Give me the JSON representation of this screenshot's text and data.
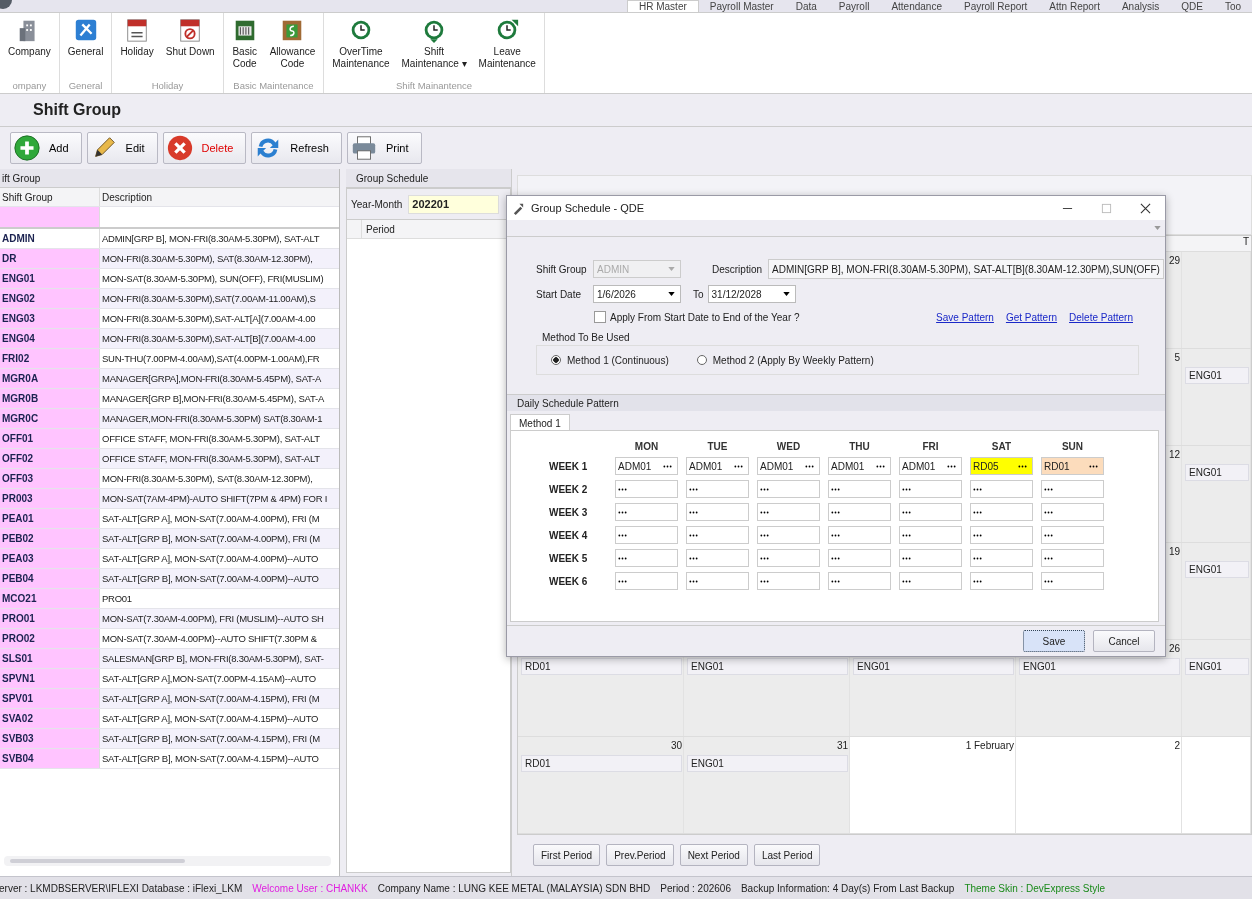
{
  "top_tabs": [
    {
      "label": "HR Master",
      "selected": true
    },
    {
      "label": "Payroll Master",
      "selected": false
    },
    {
      "label": "Data",
      "selected": false
    },
    {
      "label": "Payroll",
      "selected": false
    },
    {
      "label": "Attendance",
      "selected": false
    },
    {
      "label": "Payroll Report",
      "selected": false
    },
    {
      "label": "Attn Report",
      "selected": false
    },
    {
      "label": "Analysis",
      "selected": false
    },
    {
      "label": "QDE",
      "selected": false
    },
    {
      "label": "Too",
      "selected": false
    }
  ],
  "ribbon": [
    {
      "label": "ompany",
      "items": [
        {
          "label": "Company"
        }
      ]
    },
    {
      "label": "General",
      "items": [
        {
          "label": "General"
        }
      ]
    },
    {
      "label": "Holiday",
      "items": [
        {
          "label": "Holiday"
        },
        {
          "label": "Shut Down"
        }
      ]
    },
    {
      "label": "Basic Maintenance",
      "items": [
        {
          "label": "Basic\nCode"
        },
        {
          "label": "Allowance\nCode"
        }
      ]
    },
    {
      "label": "Shift Mainantence",
      "items": [
        {
          "label": "OverTime\nMaintenance"
        },
        {
          "label": "Shift\nMaintenance ▾"
        },
        {
          "label": "Leave\nMaintenance"
        }
      ]
    }
  ],
  "page_title": "Shift Group",
  "toolbar": [
    {
      "label": "Add"
    },
    {
      "label": "Edit"
    },
    {
      "label": "Delete",
      "color": "#e00000"
    },
    {
      "label": "Refresh"
    },
    {
      "label": "Print"
    }
  ],
  "shift_panel": {
    "title": "ift Group",
    "columns": [
      "Shift Group",
      "Description"
    ],
    "rows": [
      {
        "code": "ADMIN",
        "description": "ADMIN[GRP B], MON-FRI(8.30AM-5.30PM), SAT-ALT",
        "selected": true
      },
      {
        "code": "DR",
        "description": "MON-FRI(8.30AM-5.30PM), SAT(8.30AM-12.30PM),",
        "selected": false
      },
      {
        "code": "ENG01",
        "description": "MON-SAT(8.30AM-5.30PM), SUN(OFF), FRI(MUSLIM)",
        "selected": false
      },
      {
        "code": "ENG02",
        "description": "MON-FRI(8.30AM-5.30PM),SAT(7.00AM-11.00AM),S",
        "selected": false
      },
      {
        "code": "ENG03",
        "description": "MON-FRI(8.30AM-5.30PM),SAT-ALT[A](7.00AM-4.00",
        "selected": false
      },
      {
        "code": "ENG04",
        "description": "MON-FRI(8.30AM-5.30PM),SAT-ALT[B](7.00AM-4.00",
        "selected": false
      },
      {
        "code": "FRI02",
        "description": "SUN-THU(7.00PM-4.00AM),SAT(4.00PM-1.00AM),FR",
        "selected": false
      },
      {
        "code": "MGR0A",
        "description": "MANAGER[GRPA],MON-FRI(8.30AM-5.45PM), SAT-A",
        "selected": false
      },
      {
        "code": "MGR0B",
        "description": "MANAGER[GRP B],MON-FRI(8.30AM-5.45PM), SAT-A",
        "selected": false
      },
      {
        "code": "MGR0C",
        "description": "MANAGER,MON-FRI(8.30AM-5.30PM) SAT(8.30AM-1",
        "selected": false
      },
      {
        "code": "OFF01",
        "description": "OFFICE STAFF, MON-FRI(8.30AM-5.30PM), SAT-ALT",
        "selected": false
      },
      {
        "code": "OFF02",
        "description": "OFFICE STAFF, MON-FRI(8.30AM-5.30PM), SAT-ALT",
        "selected": false
      },
      {
        "code": "OFF03",
        "description": "MON-FRI(8.30AM-5.30PM), SAT(8.30AM-12.30PM),",
        "selected": false
      },
      {
        "code": "PR003",
        "description": "MON-SAT(7AM-4PM)-AUTO SHIFT(7PM & 4PM) FOR I",
        "selected": false
      },
      {
        "code": "PEA01",
        "description": "SAT-ALT[GRP A], MON-SAT(7.00AM-4.00PM), FRI (M",
        "selected": false
      },
      {
        "code": "PEB02",
        "description": "SAT-ALT[GRP B], MON-SAT(7.00AM-4.00PM), FRI (M",
        "selected": false
      },
      {
        "code": "PEA03",
        "description": "SAT-ALT[GRP A], MON-SAT(7.00AM-4.00PM)--AUTO",
        "selected": false
      },
      {
        "code": "PEB04",
        "description": "SAT-ALT[GRP B], MON-SAT(7.00AM-4.00PM)--AUTO",
        "selected": false
      },
      {
        "code": "MCO21",
        "description": "PRO01",
        "selected": false
      },
      {
        "code": "PRO01",
        "description": "MON-SAT(7.30AM-4.00PM), FRI (MUSLIM)--AUTO SH",
        "selected": false
      },
      {
        "code": "PRO02",
        "description": "MON-SAT(7.30AM-4.00PM)--AUTO SHIFT(7.30PM &",
        "selected": false
      },
      {
        "code": "SLS01",
        "description": "SALESMAN[GRP B], MON-FRI(8.30AM-5.30PM), SAT-",
        "selected": false
      },
      {
        "code": "SPVN1",
        "description": "SAT-ALT[GRP A],MON-SAT(7.00PM-4.15AM)--AUTO",
        "selected": false
      },
      {
        "code": "SPV01",
        "description": "SAT-ALT[GRP A], MON-SAT(7.00AM-4.15PM), FRI (M",
        "selected": false
      },
      {
        "code": "SVA02",
        "description": "SAT-ALT[GRP A], MON-SAT(7.00AM-4.15PM)--AUTO",
        "selected": false
      },
      {
        "code": "SVB03",
        "description": "SAT-ALT[GRP B], MON-SAT(7.00AM-4.15PM), FRI (M",
        "selected": false
      },
      {
        "code": "SVB04",
        "description": "SAT-ALT[GRP B], MON-SAT(7.00AM-4.15PM)--AUTO",
        "selected": false
      }
    ]
  },
  "schedule_panel": {
    "title": "Group Schedule",
    "year_month_label": "Year-Month",
    "year_month": "202201",
    "period_column": "Period"
  },
  "calendar": {
    "header": "T",
    "weeks": [
      [
        {
          "day": "29",
          "other_month": false
        },
        {
          "other_month": false
        }
      ],
      [
        {
          "day": "5",
          "other_month": false
        },
        {
          "entry": "ENG01",
          "other_month": false
        }
      ],
      [
        {
          "day": "12",
          "other_month": false
        },
        {
          "entry": "ENG01",
          "other_month": false
        }
      ],
      [
        {
          "day": "19",
          "other_month": false
        },
        {
          "entry": "ENG01",
          "other_month": false
        }
      ],
      [
        {
          "entry": "RD01",
          "other_month": false
        },
        {
          "entry": "ENG01",
          "other_month": false
        },
        {
          "entry": "ENG01",
          "other_month": false
        },
        {
          "day": "26",
          "entry": "ENG01",
          "other_month": false
        },
        {
          "entry": "ENG01",
          "other_month": false
        }
      ],
      [
        {
          "day": "30",
          "entry": "RD01",
          "other_month": false
        },
        {
          "day": "31",
          "entry": "ENG01",
          "other_month": false
        },
        {
          "day": "1 February",
          "other_month": true
        },
        {
          "day": "2",
          "other_month": true
        },
        {
          "other_month": true
        }
      ]
    ],
    "nav": [
      "First Period",
      "Prev.Period",
      "Next Period",
      "Last Period"
    ]
  },
  "dialog": {
    "title": "Group Schedule - QDE",
    "shift_group_label": "Shift Group",
    "shift_group": "ADMIN",
    "shift_group_disabled": true,
    "description_label": "Description",
    "description": "ADMIN[GRP B], MON-FRI(8.30AM-5.30PM), SAT-ALT[B](8.30AM-12.30PM),SUN(OFF)",
    "start_date_label": "Start Date",
    "start_date": "1/6/2026",
    "to_label": "To",
    "end_date": "31/12/2028",
    "apply_checkbox": {
      "label": "Apply From Start Date to End of the Year ?",
      "checked": false
    },
    "links": [
      "Save Pattern",
      "Get Pattern",
      "Delete Pattern"
    ],
    "method_group": {
      "title": "Method To Be Used",
      "options": [
        {
          "label": "Method 1 (Continuous)",
          "selected": true
        },
        {
          "label": "Method 2 (Apply By Weekly Pattern)",
          "selected": false
        }
      ]
    },
    "pattern_title": "Daily Schedule Pattern",
    "pattern_tabs": [
      {
        "label": "Method 1",
        "selected": true
      }
    ],
    "days": [
      "MON",
      "TUE",
      "WED",
      "THU",
      "FRI",
      "SAT",
      "SUN"
    ],
    "weeks": [
      {
        "label": "WEEK 1",
        "cells": [
          {
            "value": "ADM01",
            "color": "#ffffff"
          },
          {
            "value": "ADM01",
            "color": "#ffffff"
          },
          {
            "value": "ADM01",
            "color": "#ffffff"
          },
          {
            "value": "ADM01",
            "color": "#ffffff"
          },
          {
            "value": "ADM01",
            "color": "#ffffff"
          },
          {
            "value": "RD05",
            "color": "#ffff00"
          },
          {
            "value": "RD01",
            "color": "#fcdcbc"
          }
        ]
      },
      {
        "label": "WEEK 2"
      },
      {
        "label": "WEEK 3"
      },
      {
        "label": "WEEK 4"
      },
      {
        "label": "WEEK 5"
      },
      {
        "label": "WEEK 6"
      }
    ],
    "buttons": [
      {
        "label": "Save",
        "selected": true
      },
      {
        "label": "Cancel",
        "selected": false
      }
    ]
  },
  "status_bar": [
    {
      "text": "erver : LKMDBSERVER\\IFLEXI Database : iFlexi_LKM"
    },
    {
      "text": "Welcome User : CHANKK",
      "color": "#e020e0"
    },
    {
      "text": "Company Name : LUNG KEE METAL (MALAYSIA) SDN BHD"
    },
    {
      "text": "Period : 202606"
    },
    {
      "text": "Backup Information: 4 Day(s) From Last Backup"
    },
    {
      "text": "Theme Skin : DevExpress Style",
      "color": "#1a8a1a"
    }
  ]
}
